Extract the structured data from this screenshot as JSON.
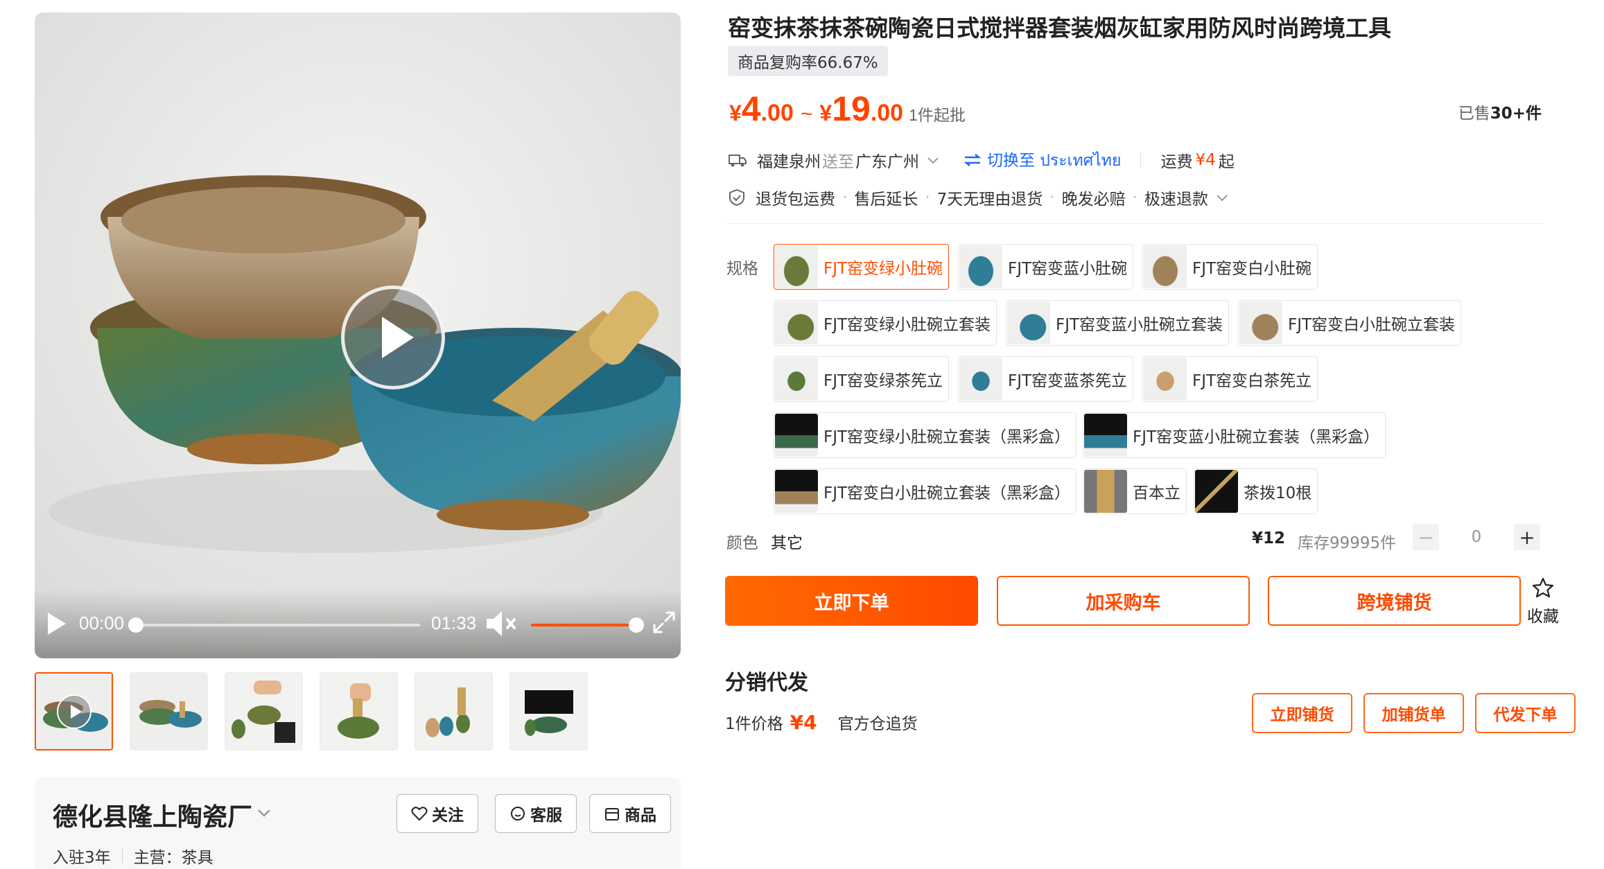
{
  "product": {
    "title": "窑变抹茶抹茶碗陶瓷日式搅拌器套装烟灰缸家用防风时尚跨境工具",
    "repeat_rate": "商品复购率66.67%"
  },
  "price": {
    "currency": "¥",
    "low_int": "4",
    "low_dec": ".00",
    "separator": "~",
    "high_int": "19",
    "high_dec": ".00",
    "moq": "1件起批",
    "sold_prefix": "已售",
    "sold_value": "30+件"
  },
  "shipping": {
    "from": "福建泉州",
    "to_word": "送至",
    "to": "广东广州",
    "switch_label": "切换至 ประเทศไทย",
    "fee_label": "运费",
    "fee_value": "¥4",
    "fee_suffix": "起"
  },
  "services": [
    "退货包运费",
    "售后延长",
    "7天无理由退货",
    "晚发必赔",
    "极速退款"
  ],
  "spec": {
    "label": "规格",
    "options": [
      {
        "label": "FJT窑变绿小肚碗",
        "selected": true
      },
      {
        "label": "FJT窑变蓝小肚碗",
        "selected": false
      },
      {
        "label": "FJT窑变白小肚碗",
        "selected": false
      },
      {
        "label": "FJT窑变绿小肚碗立套装",
        "selected": false
      },
      {
        "label": "FJT窑变蓝小肚碗立套装",
        "selected": false
      },
      {
        "label": "FJT窑变白小肚碗立套装",
        "selected": false
      },
      {
        "label": "FJT窑变绿茶筅立",
        "selected": false
      },
      {
        "label": "FJT窑变蓝茶筅立",
        "selected": false
      },
      {
        "label": "FJT窑变白茶筅立",
        "selected": false
      },
      {
        "label": "FJT窑变绿小肚碗立套装（黑彩盒）",
        "selected": false
      },
      {
        "label": "FJT窑变蓝小肚碗立套装（黑彩盒）",
        "selected": false
      },
      {
        "label": "FJT窑变白小肚碗立套装（黑彩盒）",
        "selected": false
      },
      {
        "label": "百本立",
        "selected": false
      },
      {
        "label": "茶拨10根",
        "selected": false
      }
    ]
  },
  "color": {
    "label": "颜色",
    "value": "其它",
    "unit_price": "¥12",
    "stock": "库存99995件",
    "quantity": "0",
    "minus": "−",
    "plus": "+"
  },
  "actions": {
    "order": "立即下单",
    "cart": "加采购车",
    "cross_border": "跨境铺货",
    "favorite": "收藏"
  },
  "distribution": {
    "title": "分销代发",
    "price_label": "1件价格",
    "price_value": "¥4",
    "warehouse": "官方仓追货",
    "btn_list": "立即铺货",
    "btn_add": "加铺货单",
    "btn_dropship": "代发下单"
  },
  "video": {
    "current_time": "00:00",
    "duration": "01:33",
    "progress": 0,
    "volume": 1.0
  },
  "shop": {
    "name": "德化县隆上陶瓷厂",
    "years": "入驻3年",
    "main_label": "主营：",
    "main_value": "茶具",
    "follow": "关注",
    "service": "客服",
    "products": "商品"
  },
  "colors": {
    "accent": "#ff5000",
    "price": "#ff4400",
    "link": "#1a66ff"
  }
}
